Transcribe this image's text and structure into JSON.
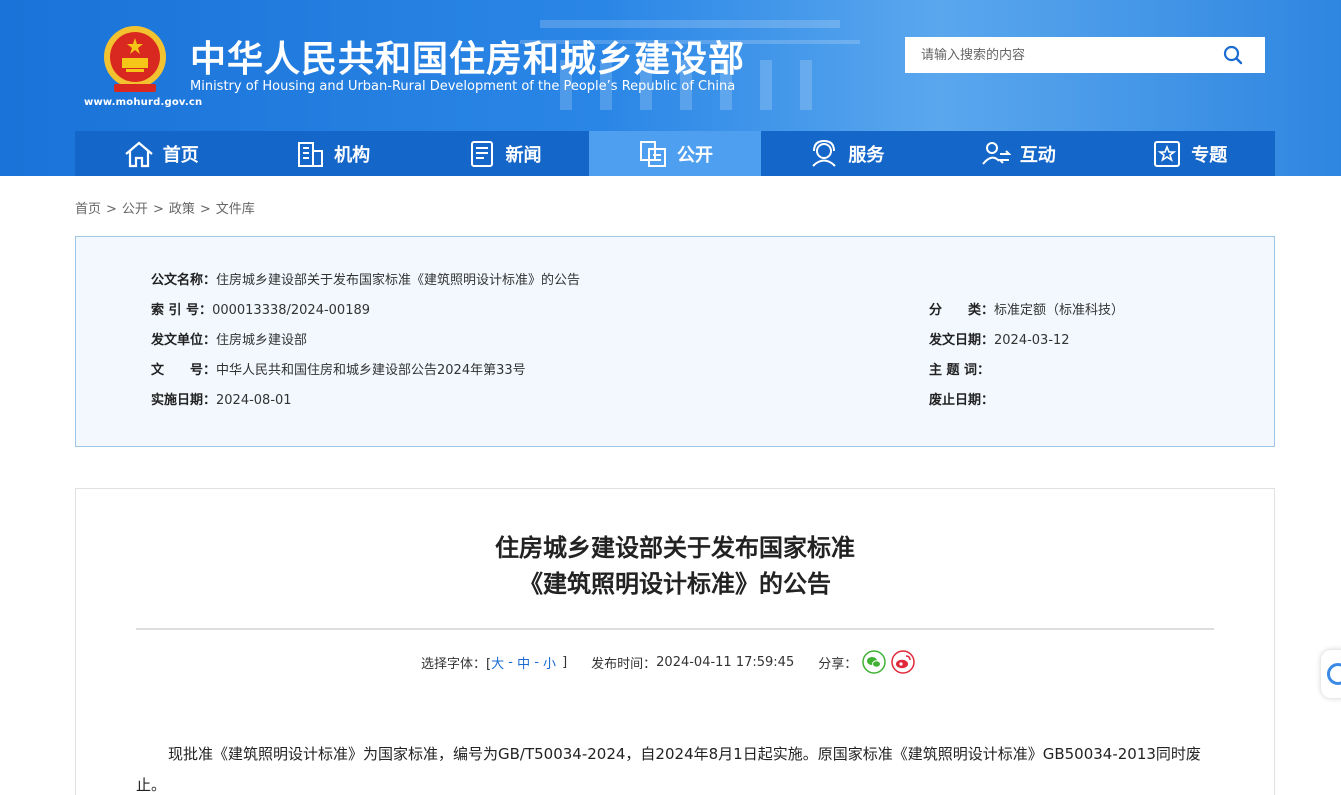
{
  "header": {
    "site_url": "www.mohurd.gov.cn",
    "title": "中华人民共和国住房和城乡建设部",
    "subtitle": "Ministry of Housing and Urban-Rural Development of the People’s Republic of China",
    "search_placeholder": "请输入搜索的内容"
  },
  "nav": [
    {
      "label": "首页",
      "icon": "home-icon"
    },
    {
      "label": "机构",
      "icon": "building-icon"
    },
    {
      "label": "新闻",
      "icon": "news-icon"
    },
    {
      "label": "公开",
      "icon": "document-icon",
      "active": true
    },
    {
      "label": "服务",
      "icon": "service-icon"
    },
    {
      "label": "互动",
      "icon": "interact-icon"
    },
    {
      "label": "专题",
      "icon": "topic-icon"
    }
  ],
  "breadcrumb": [
    "首页",
    "公开",
    "政策",
    "文件库"
  ],
  "breadcrumb_sep": ">",
  "info": {
    "doc_name_label": "公文名称：",
    "doc_name": "住房城乡建设部关于发布国家标准《建筑照明设计标准》的公告",
    "index_label": "索 引 号：",
    "index": "000013338/2024-00189",
    "category_label": "分　　类：",
    "category": "标准定额（标准科技）",
    "issuer_label": "发文单位：",
    "issuer": "住房城乡建设部",
    "issue_date_label": "发文日期：",
    "issue_date": "2024-03-12",
    "doc_no_label": "文　　号：",
    "doc_no": "中华人民共和国住房和城乡建设部公告2024年第33号",
    "keywords_label": "主 题 词：",
    "keywords": "",
    "effective_label": "实施日期：",
    "effective": "2024-08-01",
    "repeal_label": "废止日期：",
    "repeal": ""
  },
  "article": {
    "title_line1": "住房城乡建设部关于发布国家标准",
    "title_line2": "《建筑照明设计标准》的公告",
    "font_label": "选择字体：[",
    "font_large": "大",
    "font_medium": "中",
    "font_small": "小",
    "font_sep": " - ",
    "font_close": "]",
    "publish_label": "发布时间：",
    "publish_time": "2024-04-11 17:59:45",
    "share_label": "分享：",
    "body": "现批准《建筑照明设计标准》为国家标准，编号为GB/T50034-2024，自2024年8月1日起实施。原国家标准《建筑照明设计标准》GB50034-2013同时废止。"
  },
  "colors": {
    "nav_bg": "#1466c8",
    "nav_active": "#4f9ff0",
    "wechat": "#3fb234",
    "weibo": "#e0293a"
  }
}
